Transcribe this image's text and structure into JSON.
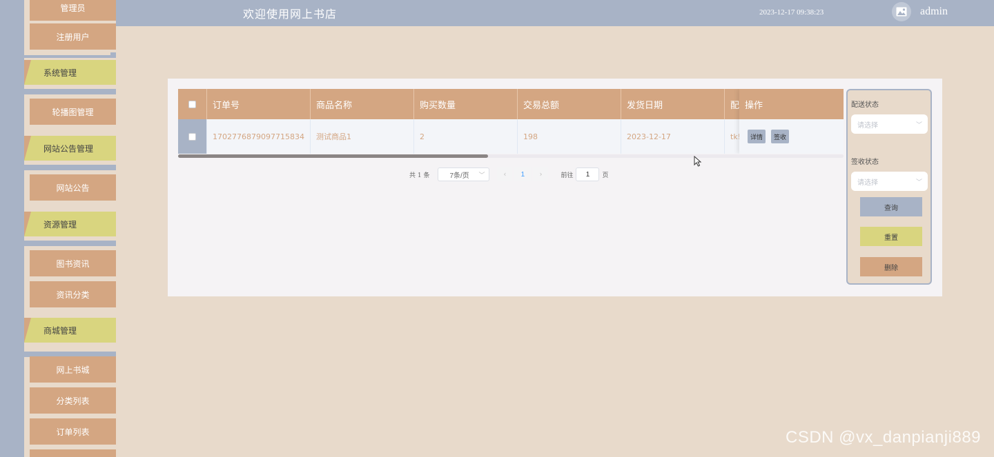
{
  "header": {
    "title": "欢迎使用网上书店",
    "datetime": "2023-12-17 09:38:23",
    "user": "admin"
  },
  "sidebar": {
    "items": [
      {
        "label": "管理员",
        "type": "sub"
      },
      {
        "label": "注册用户",
        "type": "sub"
      },
      {
        "label": "系统管理",
        "type": "group"
      },
      {
        "label": "轮播图管理",
        "type": "sub"
      },
      {
        "label": "网站公告管理",
        "type": "group"
      },
      {
        "label": "网站公告",
        "type": "sub"
      },
      {
        "label": "资源管理",
        "type": "group"
      },
      {
        "label": "图书资讯",
        "type": "sub"
      },
      {
        "label": "资讯分类",
        "type": "sub"
      },
      {
        "label": "商城管理",
        "type": "group"
      },
      {
        "label": "网上书城",
        "type": "sub"
      },
      {
        "label": "分类列表",
        "type": "sub"
      },
      {
        "label": "订单列表",
        "type": "sub"
      }
    ]
  },
  "table": {
    "columns": [
      "订单号",
      "商品名称",
      "购买数量",
      "交易总额",
      "发货日期",
      "配"
    ],
    "op_header": "操作",
    "rows": [
      {
        "order_no": "1702776879097715834",
        "product": "测试商品1",
        "qty": "2",
        "total": "198",
        "ship_date": "2023-12-17",
        "delivery": "tk!",
        "actions": [
          "详情",
          "签收"
        ]
      }
    ]
  },
  "pagination": {
    "total": "共 1 条",
    "page_size": "7条/页",
    "current_page": "1",
    "goto_label": "前往",
    "goto_value": "1",
    "page_suffix": "页"
  },
  "filter": {
    "delivery_label": "配送状态",
    "delivery_placeholder": "请选择",
    "sign_label": "签收状态",
    "sign_placeholder": "请选择",
    "query": "查询",
    "reset": "重置",
    "delete": "删除"
  },
  "watermark": "CSDN @vx_danpianji889",
  "colors": {
    "accent_tan": "#d4a682",
    "accent_olive": "#d9d57f",
    "slate": "#a8b3c6",
    "background": "#e8dacb"
  }
}
